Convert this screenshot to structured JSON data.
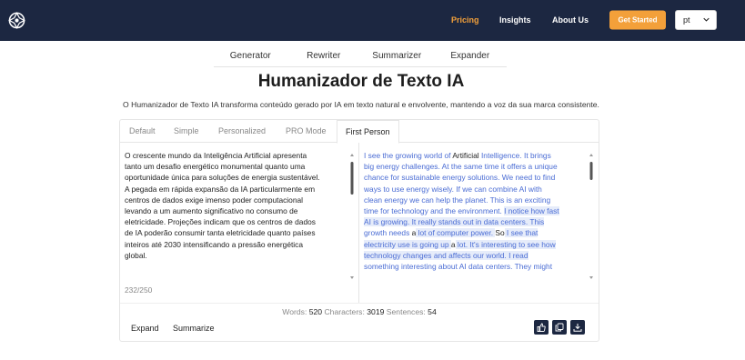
{
  "nav": {
    "links": [
      "Pricing",
      "Insights",
      "About Us"
    ],
    "active": "Pricing",
    "cta_label": "Get Started",
    "language": "pt",
    "accent_color": "#f3a03a",
    "bg_color": "#1c2741"
  },
  "tool_tabs": [
    "Generator",
    "Rewriter",
    "Summarizer",
    "Expander"
  ],
  "title": "Humanizador de Texto IA",
  "subtitle": "O Humanizador de Texto IA transforma conteúdo gerado por IA em texto natural e envolvente, mantendo a voz da sua marca consistente.",
  "mode_tabs": [
    "Default",
    "Simple",
    "Personalized",
    "PRO Mode",
    "First Person"
  ],
  "active_mode": "First Person",
  "input": {
    "lines": [
      "O crescente mundo da Inteligência Artificial apresenta",
      "tanto um desafio energético monumental quanto uma",
      "oportunidade única para soluções de energia sustentável.",
      "A pegada em rápida expansão da IA particularmente em",
      "centros de dados exige imenso poder computacional",
      "levando a um aumento significativo no consumo de",
      "eletricidade. Projeções indicam que os centros de dados",
      "de IA poderão consumir tanta eletricidade quanto países",
      "inteiros até 2030 intensificando a pressão energética",
      "global."
    ],
    "char_count": "232/250"
  },
  "output": {
    "segments": [
      {
        "t": "I see the growing world of ",
        "k": "n"
      },
      {
        "t": "Artificial",
        "k": "p"
      },
      {
        "t": " Intelligence. It brings",
        "k": "n"
      },
      {
        "t": "big energy challenges. At the same time it offers a unique",
        "k": "n"
      },
      {
        "t": "chance for sustainable energy solutions. We need to find",
        "k": "n"
      },
      {
        "t": "ways to use energy wisely. If we can combine AI with",
        "k": "n"
      },
      {
        "t": "clean energy we can help the planet. This is an exciting",
        "k": "n"
      },
      {
        "t": "time for technology and the environment. ",
        "k": "n"
      },
      {
        "t": "I notice how fast",
        "k": "h"
      },
      {
        "t": "AI is growing. It really stands out in data centers. This",
        "k": "h"
      },
      {
        "t": "growth needs ",
        "k": "n"
      },
      {
        "t": "a",
        "k": "p"
      },
      {
        "t": " lot of computer power. ",
        "k": "h"
      },
      {
        "t": "So",
        "k": "p"
      },
      {
        "t": " I see that",
        "k": "h"
      },
      {
        "t": "electricity use is going up ",
        "k": "h"
      },
      {
        "t": "a",
        "k": "p"
      },
      {
        "t": " lot. It's interesting to see how",
        "k": "h"
      },
      {
        "t": "technology changes and affects our world. I read",
        "k": "h"
      },
      {
        "t": "something interesting about AI data centers. They might",
        "k": "n"
      }
    ]
  },
  "stats": {
    "words_label": "Words:",
    "words": "520",
    "chars_label": "Characters:",
    "chars": "3019",
    "sentences_label": "Sentences:",
    "sentences": "54"
  },
  "actions": [
    "Expand",
    "Summarize"
  ],
  "icon_buttons": [
    "thumbs-up-icon",
    "copy-icon",
    "download-icon"
  ]
}
